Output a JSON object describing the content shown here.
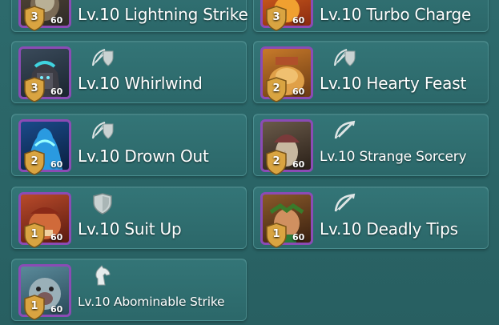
{
  "colors": {
    "background": "#2a6567",
    "card": "#317173",
    "portrait_border_epic": "#8b4bb5",
    "shield_gold": "#d9a441",
    "text": "#ffffff"
  },
  "commanders": [
    {
      "skill": "Lv.10 Lightning Strike",
      "stars": "3",
      "level": "60",
      "type_icon": "skill-type-icon"
    },
    {
      "skill": "Lv.10 Turbo Charge",
      "stars": "3",
      "level": "60",
      "type_icon": "skill-type-icon"
    },
    {
      "skill": "Lv.10 Whirlwind",
      "stars": "3",
      "level": "60",
      "type_icon": "archer-infantry-icon"
    },
    {
      "skill": "Lv.10 Hearty Feast",
      "stars": "2",
      "level": "60",
      "type_icon": "archer-infantry-icon"
    },
    {
      "skill": "Lv.10 Drown Out",
      "stars": "2",
      "level": "60",
      "type_icon": "archer-infantry-icon"
    },
    {
      "skill": "Lv.10 Strange Sorcery",
      "stars": "2",
      "level": "60",
      "type_icon": "bow-icon"
    },
    {
      "skill": "Lv.10 Suit Up",
      "stars": "1",
      "level": "60",
      "type_icon": "shield-icon"
    },
    {
      "skill": "Lv.10 Deadly Tips",
      "stars": "1",
      "level": "60",
      "type_icon": "bow-icon"
    },
    {
      "skill": "Lv.10 Abominable Strike",
      "stars": "1",
      "level": "60",
      "type_icon": "horse-icon"
    }
  ]
}
